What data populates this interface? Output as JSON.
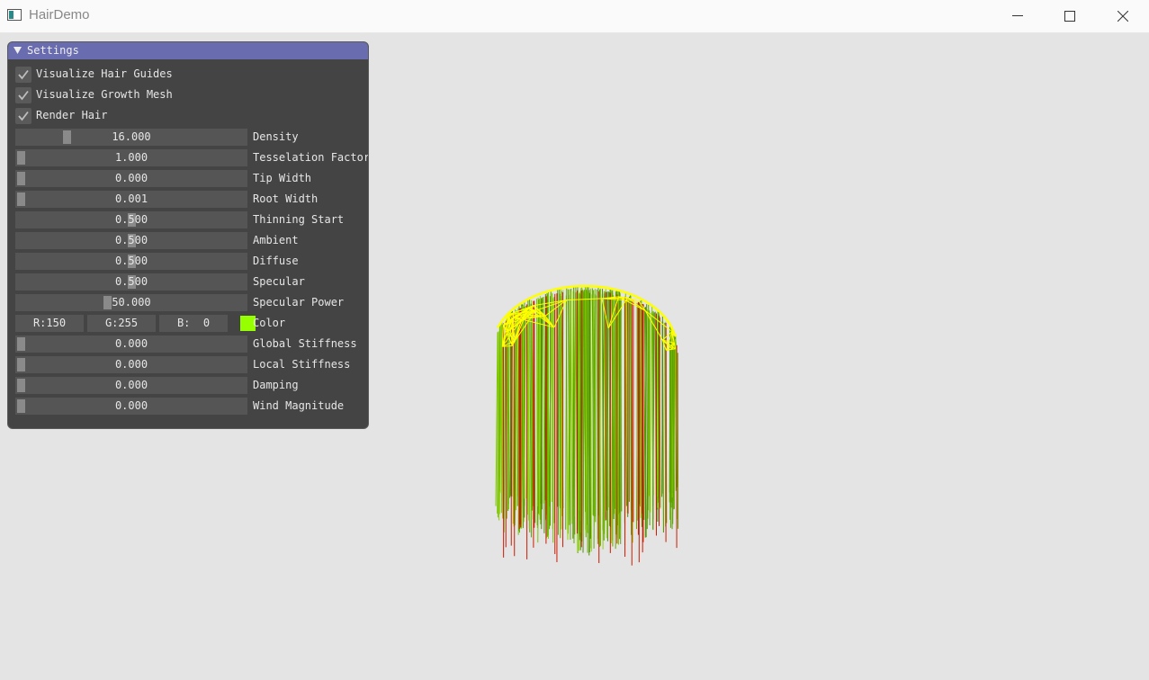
{
  "window": {
    "title": "HairDemo"
  },
  "settings": {
    "title": "Settings",
    "checkboxes": [
      {
        "label": "Visualize Hair Guides",
        "checked": true
      },
      {
        "label": "Visualize Growth Mesh",
        "checked": true
      },
      {
        "label": "Render Hair",
        "checked": true
      }
    ],
    "sliders": [
      {
        "label": "Density",
        "value": "16.000",
        "fraction": 0.21
      },
      {
        "label": "Tesselation Factor",
        "value": "1.000",
        "fraction": 0
      },
      {
        "label": "Tip Width",
        "value": "0.000",
        "fraction": 0
      },
      {
        "label": "Root Width",
        "value": "0.001",
        "fraction": 0
      },
      {
        "label": "Thinning Start",
        "value": "0.500",
        "fraction": 0.5
      },
      {
        "label": "Ambient",
        "value": "0.500",
        "fraction": 0.5
      },
      {
        "label": "Diffuse",
        "value": "0.500",
        "fraction": 0.5
      },
      {
        "label": "Specular",
        "value": "0.500",
        "fraction": 0.5
      },
      {
        "label": "Specular Power",
        "value": "50.000",
        "fraction": 0.39
      }
    ],
    "color": {
      "label": "Color",
      "r": "R:150",
      "g": "G:255",
      "b": "B:  0",
      "swatch": "#96ff00"
    },
    "sliders2": [
      {
        "label": "Global Stiffness",
        "value": "0.000",
        "fraction": 0
      },
      {
        "label": "Local Stiffness",
        "value": "0.000",
        "fraction": 0
      },
      {
        "label": "Damping",
        "value": "0.000",
        "fraction": 0
      },
      {
        "label": "Wind Magnitude",
        "value": "0.000",
        "fraction": 0
      }
    ]
  },
  "colors": {
    "header": "#6a6cb0",
    "panel_bg": "#444444",
    "viewport_bg": "#e4e4e4",
    "hair": "#5aa000",
    "hair_guides": "#cc1a00",
    "growth_mesh": "#ffff00"
  }
}
